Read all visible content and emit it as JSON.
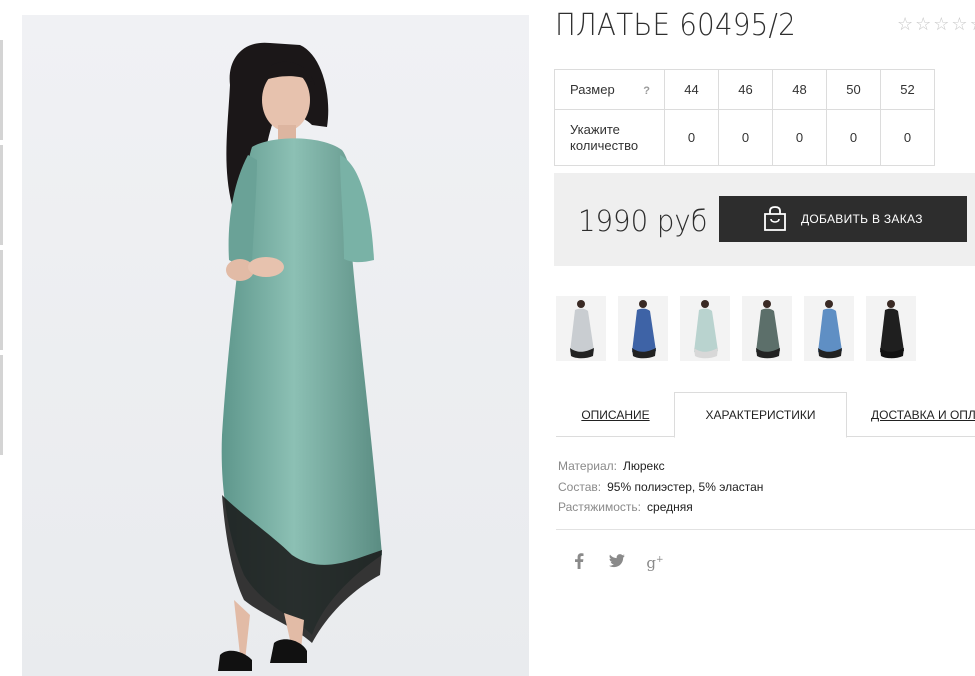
{
  "product": {
    "title": "ПЛАТЬЕ 60495/2",
    "rating": {
      "filled": 0,
      "total": 5,
      "icon": "star-outline-icon"
    }
  },
  "size_table": {
    "size_label": "Размер",
    "help_glyph": "?",
    "quantity_label": "Укажите количество",
    "sizes": [
      "44",
      "46",
      "48",
      "50",
      "52"
    ],
    "quantities": [
      "0",
      "0",
      "0",
      "0",
      "0"
    ]
  },
  "order": {
    "price": "1990 руб",
    "button_label": "ДОБАВИТЬ В ЗАКАЗ",
    "button_icon": "shopping-bag-icon",
    "button_color": "#2d2d2d"
  },
  "thumbnails": [
    {
      "color": "#c9cdd1"
    },
    {
      "color": "#3e63a6"
    },
    {
      "color": "#b9d3cf"
    },
    {
      "color": "#5c6f6a"
    },
    {
      "color": "#5f8fc4"
    },
    {
      "color": "#1f1f1f"
    }
  ],
  "tabs": [
    {
      "label": "ОПИСАНИЕ",
      "active": false
    },
    {
      "label": "ХАРАКТЕРИСТИКИ",
      "active": true
    },
    {
      "label": "ДОСТАВКА И ОПЛАТА",
      "active": false
    }
  ],
  "specs": [
    {
      "key": "Материал:",
      "value": "Люрекс"
    },
    {
      "key": "Состав:",
      "value": "95% полиэстер, 5% эластан"
    },
    {
      "key": "Растяжимость:",
      "value": "средняя"
    }
  ],
  "social": [
    {
      "icon": "facebook-icon",
      "glyph": "f"
    },
    {
      "icon": "twitter-icon",
      "glyph": "🐦"
    },
    {
      "icon": "google-plus-icon",
      "glyph": "g+"
    }
  ],
  "colors": {
    "dress": "#6fa89c",
    "lace": "#1a1a1a",
    "price_bg": "#efefef"
  }
}
